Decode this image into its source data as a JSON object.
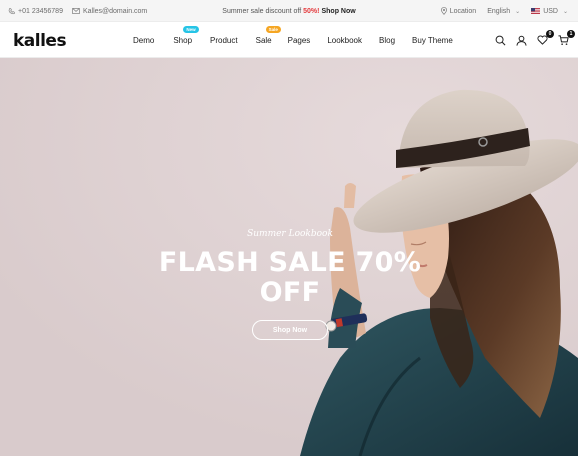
{
  "topbar": {
    "phone": "+01 23456789",
    "email": "Kalles@domain.com",
    "promo_text": "Summer sale discount off",
    "promo_percent": "50%!",
    "promo_link": "Shop Now",
    "location": "Location",
    "language": "English",
    "currency": "USD"
  },
  "header": {
    "logo": "kalles",
    "nav": [
      {
        "label": "Demo"
      },
      {
        "label": "Shop",
        "badge": "New"
      },
      {
        "label": "Product"
      },
      {
        "label": "Sale",
        "badge": "Sale"
      },
      {
        "label": "Pages"
      },
      {
        "label": "Lookbook"
      },
      {
        "label": "Blog"
      },
      {
        "label": "Buy Theme"
      }
    ],
    "wishlist_count": "0",
    "cart_count": "1"
  },
  "hero": {
    "subtitle": "Summer Lookbook",
    "title_line1": "FLASH SALE 70%",
    "title_line2": "OFF",
    "button": "Shop Now"
  },
  "colors": {
    "accent": "#e4393c",
    "badge_new": "#26c4e6",
    "badge_sale": "#f5a623",
    "hero_bg": "#dfd2d3"
  },
  "icons": [
    "phone-icon",
    "mail-icon",
    "location-icon",
    "flag-us-icon",
    "search-icon",
    "user-icon",
    "heart-icon",
    "cart-icon"
  ]
}
